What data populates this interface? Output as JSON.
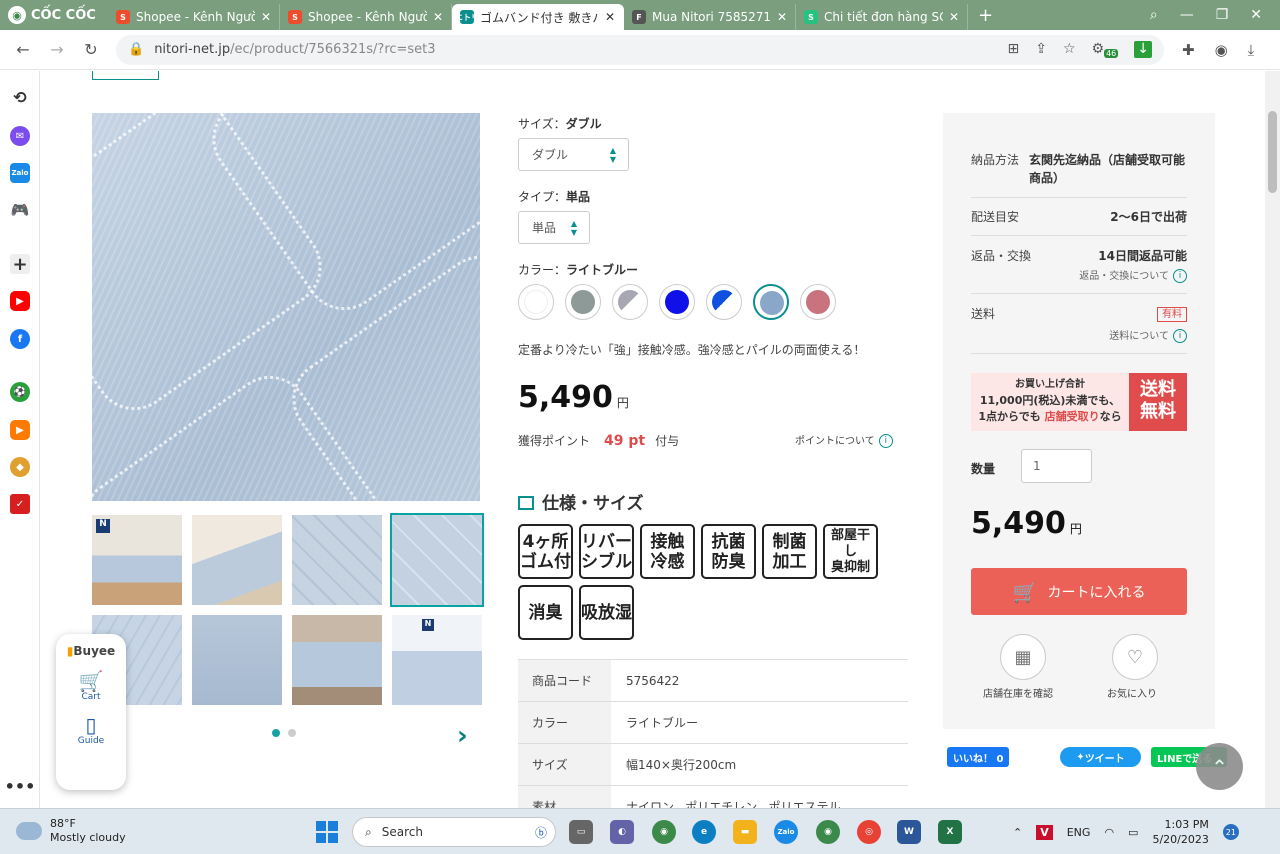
{
  "browser": {
    "brand": "CỐC CỐC",
    "tabs": [
      {
        "title": "Shopee - Kênh Ngườ",
        "favicon_color": "#ee4d2d",
        "favicon_label": "S",
        "active": false
      },
      {
        "title": "Shopee - Kênh Ngườ",
        "favicon_color": "#ee4d2d",
        "favicon_label": "S",
        "active": false
      },
      {
        "title": "ゴムバンド付き 敷きパッ",
        "favicon_color": "#0a8f8f",
        "favicon_label": "ニトリ",
        "active": true
      },
      {
        "title": "Mua Nitori 7585271",
        "favicon_color": "#555555",
        "favicon_label": "F",
        "active": false
      },
      {
        "title": "Chi tiết đơn hàng SC",
        "favicon_color": "#26c281",
        "favicon_label": "S",
        "active": false
      }
    ],
    "url_host": "nitori-net.jp",
    "url_path": "/ec/product/7566321s/?rc=set3",
    "extension_badge": "46"
  },
  "product": {
    "size_label": "サイズ：",
    "size_value": "ダブル",
    "size_select": "ダブル",
    "type_label": "タイプ：",
    "type_value": "単品",
    "type_select": "単品",
    "color_label": "カラー：",
    "color_value": "ライトブルー",
    "description": "定番より冷たい「強」接触冷感。強冷感とパイルの両面使える！",
    "price": "5,490",
    "currency": "円",
    "points_label": "獲得ポイント",
    "points_value": "49 pt",
    "points_suffix": "付与",
    "points_link": "ポイントについて",
    "spec_title": "仕様・サイズ",
    "badges": [
      "4ヶ所\nゴム付",
      "リバー\nシブル",
      "接触\n冷感",
      "抗菌\n防臭",
      "制菌\n加工",
      "部屋干し\n臭抑制",
      "消臭",
      "吸放湿"
    ],
    "spec_rows": [
      {
        "key": "商品コード",
        "value": "5756422"
      },
      {
        "key": "カラー",
        "value": "ライトブルー"
      },
      {
        "key": "サイズ",
        "value": "幅140×奥行200cm"
      },
      {
        "key": "素材",
        "value": "ナイロン、ポリエチレン、ポリエステル"
      }
    ]
  },
  "swatches": [
    {
      "color": "#ffffff"
    },
    {
      "color": "#8d9a98"
    },
    {
      "color": "#a7a7b3"
    },
    {
      "color": "#1010e8"
    },
    {
      "color": "#1050e0"
    },
    {
      "color": "#8aa6c9"
    },
    {
      "color": "#c9737f"
    }
  ],
  "delivery": {
    "method_label": "納品方法",
    "method_value": "玄関先迄納品（店舗受取可能商品）",
    "eta_label": "配送目安",
    "eta_value": "2〜6日で出荷",
    "return_label": "返品・交換",
    "return_value": "14日間返品可能",
    "return_link": "返品・交換について",
    "shipping_label": "送料",
    "shipping_tag": "有料",
    "shipping_link": "送料について"
  },
  "banner": {
    "line1": "お買い上げ合計",
    "line2": "11,000円(税込)未満でも、",
    "line3a": "1点からでも",
    "line3b": "店舗受取り",
    "line3c": "なら",
    "free1": "送料",
    "free2": "無料"
  },
  "purchase": {
    "qty_label": "数量",
    "qty_value": "1",
    "price": "5,490",
    "currency": "円",
    "cart_button": "カートに入れる",
    "store_stock": "店舗在庫を確認",
    "favorite": "お気に入り"
  },
  "social": {
    "like": "いいね！ 0",
    "tweet": "ツイート",
    "line": "LINEで送る"
  },
  "buyee": {
    "brand": "Buyee",
    "cart": "Cart",
    "guide": "Guide"
  },
  "taskbar": {
    "temp": "88°F",
    "weather": "Mostly cloudy",
    "search": "Search",
    "lang": "ENG",
    "time": "1:03 PM",
    "date": "5/20/2023",
    "notif": "21"
  }
}
